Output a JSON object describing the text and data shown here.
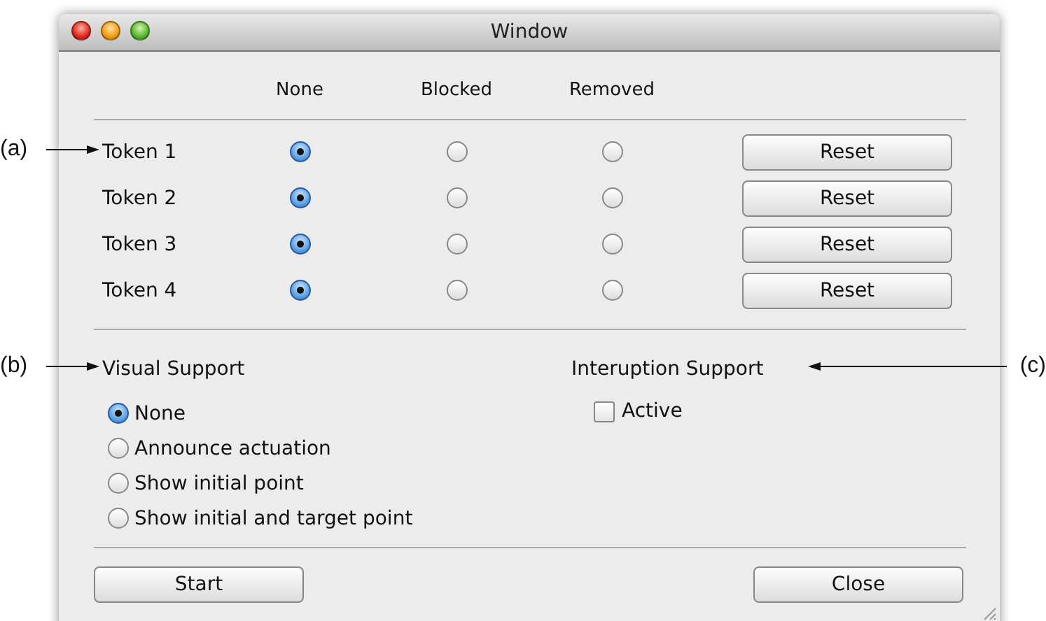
{
  "window": {
    "title": "Window"
  },
  "columns": [
    "None",
    "Blocked",
    "Removed"
  ],
  "tokens": [
    {
      "label": "Token 1",
      "choices": [
        {
          "selected": true
        },
        {
          "selected": false
        },
        {
          "selected": false
        }
      ],
      "button": "Reset"
    },
    {
      "label": "Token 2",
      "choices": [
        {
          "selected": true
        },
        {
          "selected": false
        },
        {
          "selected": false
        }
      ],
      "button": "Reset"
    },
    {
      "label": "Token 3",
      "choices": [
        {
          "selected": true
        },
        {
          "selected": false
        },
        {
          "selected": false
        }
      ],
      "button": "Reset"
    },
    {
      "label": "Token 4",
      "choices": [
        {
          "selected": true
        },
        {
          "selected": false
        },
        {
          "selected": false
        }
      ],
      "button": "Reset"
    }
  ],
  "visual_support": {
    "label": "Visual Support",
    "options": [
      {
        "label": "None",
        "selected": true
      },
      {
        "label": "Announce actuation",
        "selected": false
      },
      {
        "label": "Show initial point",
        "selected": false
      },
      {
        "label": "Show initial and target point",
        "selected": false
      }
    ]
  },
  "interruption_support": {
    "label": "Interuption Support",
    "checkbox": {
      "label": "Active",
      "checked": false
    }
  },
  "buttons": [
    "Start",
    "Close"
  ],
  "annotations": [
    {
      "label": "(a)",
      "kind": "left"
    },
    {
      "label": "(b)",
      "kind": "left"
    },
    {
      "label": "(c)",
      "kind": "right"
    }
  ]
}
